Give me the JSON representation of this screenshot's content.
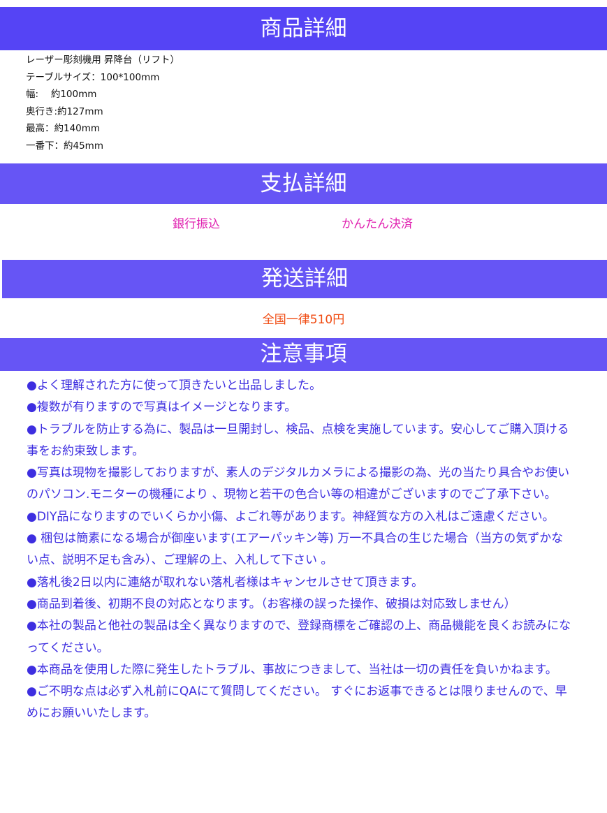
{
  "sections": {
    "product_title": "商品詳細",
    "payment_title": "支払詳細",
    "shipping_title": "発送詳細",
    "notes_title": "注意事項"
  },
  "product": {
    "lines": [
      "レーザー彫刻機用 昇降台（リフト）",
      "テーブルサイズ：100*100mm",
      "幅:　 約100mm",
      "奥行き:約127mm",
      "最高：約140mm",
      "一番下：約45mm"
    ]
  },
  "payment": {
    "methods": [
      "銀行振込",
      "かんたん決済"
    ]
  },
  "shipping": {
    "fee": "全国一律510円"
  },
  "notes": [
    "●よく理解された方に使って頂きたいと出品しました。",
    "●複数が有りますので写真はイメージとなります。",
    "●トラブルを防止する為に、製品は一旦開封し、検品、点検を実施しています。安心してご購入頂ける事をお約束致します。",
    "●写真は現物を撮影しておりますが、素人のデジタルカメラによる撮影の為、光の当たり具合やお使いのパソコン.モニターの機種により 、現物と若干の色合い等の相違がございますのでご了承下さい。",
    "●DIY品になりますのでいくらか小傷、よごれ等があります。神経質な方の入札はご遠慮ください。",
    "● 梱包は簡素になる場合が御座います(エアーパッキン等) 万一不具合の生じた場合（当方の気ずかない点、説明不足も含み）、ご理解の上、入札して下さい 。",
    "●落札後2日以内に連絡が取れない落札者様はキャンセルさせて頂きます。",
    "●商品到着後、初期不良の対応となります。（お客様の誤った操作、破損は対応致しません）",
    "●本社の製品と他社の製品は全く異なりますので、登録商標をご確認の上、商品機能を良くお読みになってください。",
    "●本商品を使用した際に発生したトラブル、事故につきまして、当社は一切の責任を負いかねます。",
    "●ご不明な点は必ず入札前にQAにて質問してください。 すぐにお返事できるとは限りませんので、早めにお願いいたします。"
  ]
}
